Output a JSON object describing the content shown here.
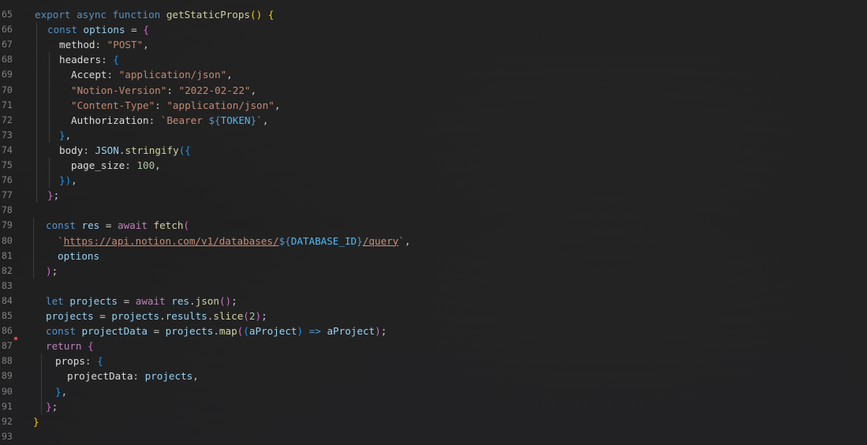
{
  "editor": {
    "lines": [
      {
        "n": "65",
        "tokens": [
          [
            "kw",
            "export "
          ],
          [
            "kw",
            "async "
          ],
          [
            "kw",
            "function "
          ],
          [
            "fn",
            "getStaticProps"
          ],
          [
            "b1",
            "() {"
          ]
        ]
      },
      {
        "n": "66",
        "tokens": [
          [
            "kw",
            "const "
          ],
          [
            "var",
            "options"
          ],
          [
            "punc",
            " = "
          ],
          [
            "b2",
            "{"
          ]
        ]
      },
      {
        "n": "67",
        "tokens": [
          [
            "prop",
            "method"
          ],
          [
            "punc",
            ": "
          ],
          [
            "str",
            "\"POST\""
          ],
          [
            "punc",
            ","
          ]
        ]
      },
      {
        "n": "68",
        "tokens": [
          [
            "prop",
            "headers"
          ],
          [
            "punc",
            ": "
          ],
          [
            "b3",
            "{"
          ]
        ]
      },
      {
        "n": "69",
        "tokens": [
          [
            "prop",
            "Accept"
          ],
          [
            "punc",
            ": "
          ],
          [
            "str",
            "\"application/json\""
          ],
          [
            "punc",
            ","
          ]
        ]
      },
      {
        "n": "70",
        "tokens": [
          [
            "str",
            "\"Notion-Version\""
          ],
          [
            "punc",
            ": "
          ],
          [
            "str",
            "\"2022-02-22\""
          ],
          [
            "punc",
            ","
          ]
        ]
      },
      {
        "n": "71",
        "tokens": [
          [
            "str",
            "\"Content-Type\""
          ],
          [
            "punc",
            ": "
          ],
          [
            "str",
            "\"application/json\""
          ],
          [
            "punc",
            ","
          ]
        ]
      },
      {
        "n": "72",
        "tokens": [
          [
            "prop",
            "Authorization"
          ],
          [
            "punc",
            ": "
          ],
          [
            "str",
            "`Bearer "
          ],
          [
            "tpl",
            "${"
          ],
          [
            "tplvar",
            "TOKEN"
          ],
          [
            "tpl",
            "}"
          ],
          [
            "str",
            "`"
          ],
          [
            "punc",
            ","
          ]
        ]
      },
      {
        "n": "73",
        "tokens": [
          [
            "b3",
            "}"
          ],
          [
            "punc",
            ","
          ]
        ]
      },
      {
        "n": "74",
        "tokens": [
          [
            "prop",
            "body"
          ],
          [
            "punc",
            ": "
          ],
          [
            "var",
            "JSON"
          ],
          [
            "punc",
            "."
          ],
          [
            "fn",
            "stringify"
          ],
          [
            "b3",
            "({"
          ]
        ]
      },
      {
        "n": "75",
        "tokens": [
          [
            "prop",
            "page_size"
          ],
          [
            "punc",
            ": "
          ],
          [
            "num",
            "100"
          ],
          [
            "punc",
            ","
          ]
        ]
      },
      {
        "n": "76",
        "tokens": [
          [
            "b3",
            "})"
          ],
          [
            "punc",
            ","
          ]
        ]
      },
      {
        "n": "77",
        "tokens": [
          [
            "b2",
            "}"
          ],
          [
            "punc",
            ";"
          ]
        ]
      },
      {
        "n": "78",
        "tokens": []
      },
      {
        "n": "79",
        "tokens": [
          [
            "kw",
            "const "
          ],
          [
            "var",
            "res"
          ],
          [
            "punc",
            " = "
          ],
          [
            "kw2",
            "await "
          ],
          [
            "fn",
            "fetch"
          ],
          [
            "b2",
            "("
          ]
        ]
      },
      {
        "n": "80",
        "tokens": [
          [
            "str",
            "`"
          ],
          [
            "url",
            "https://api.notion.com/v1/databases/"
          ],
          [
            "tpl",
            "${"
          ],
          [
            "tplvar",
            "DATABASE_ID"
          ],
          [
            "tpl",
            "}"
          ],
          [
            "url",
            "/query"
          ],
          [
            "str",
            "`"
          ],
          [
            "punc",
            ","
          ]
        ]
      },
      {
        "n": "81",
        "tokens": [
          [
            "var",
            "options"
          ]
        ]
      },
      {
        "n": "82",
        "tokens": [
          [
            "b2",
            ")"
          ],
          [
            "punc",
            ";"
          ]
        ]
      },
      {
        "n": "83",
        "tokens": []
      },
      {
        "n": "84",
        "tokens": [
          [
            "kw",
            "let "
          ],
          [
            "var",
            "projects"
          ],
          [
            "punc",
            " = "
          ],
          [
            "kw2",
            "await "
          ],
          [
            "var",
            "res"
          ],
          [
            "punc",
            "."
          ],
          [
            "fn",
            "json"
          ],
          [
            "b2",
            "()"
          ],
          [
            "punc",
            ";"
          ]
        ]
      },
      {
        "n": "85",
        "tokens": [
          [
            "var",
            "projects"
          ],
          [
            "punc",
            " = "
          ],
          [
            "var",
            "projects"
          ],
          [
            "punc",
            "."
          ],
          [
            "var",
            "results"
          ],
          [
            "punc",
            "."
          ],
          [
            "fn",
            "slice"
          ],
          [
            "b2",
            "("
          ],
          [
            "num",
            "2"
          ],
          [
            "b2",
            ")"
          ],
          [
            "punc",
            ";"
          ]
        ]
      },
      {
        "n": "86",
        "tokens": [
          [
            "kw",
            "const "
          ],
          [
            "var",
            "projectData"
          ],
          [
            "punc",
            " = "
          ],
          [
            "var",
            "projects"
          ],
          [
            "punc",
            "."
          ],
          [
            "fn",
            "map"
          ],
          [
            "b2",
            "("
          ],
          [
            "b3",
            "("
          ],
          [
            "var",
            "aProject"
          ],
          [
            "b3",
            ")"
          ],
          [
            "kw",
            " => "
          ],
          [
            "var",
            "aProject"
          ],
          [
            "b2",
            ")"
          ],
          [
            "punc",
            ";"
          ]
        ]
      },
      {
        "n": "87",
        "tokens": [
          [
            "kw2",
            "return "
          ],
          [
            "b2",
            "{"
          ]
        ]
      },
      {
        "n": "88",
        "tokens": [
          [
            "prop",
            "props"
          ],
          [
            "punc",
            ": "
          ],
          [
            "b3",
            "{"
          ]
        ]
      },
      {
        "n": "89",
        "tokens": [
          [
            "prop",
            "projectData"
          ],
          [
            "punc",
            ": "
          ],
          [
            "var",
            "projects"
          ],
          [
            "punc",
            ","
          ]
        ]
      },
      {
        "n": "90",
        "tokens": [
          [
            "b3",
            "}"
          ],
          [
            "punc",
            ","
          ]
        ]
      },
      {
        "n": "91",
        "tokens": [
          [
            "b2",
            "}"
          ],
          [
            "punc",
            ";"
          ]
        ]
      },
      {
        "n": "92",
        "tokens": [
          [
            "b1",
            "}"
          ]
        ]
      },
      {
        "n": "93",
        "tokens": []
      }
    ]
  },
  "colors": {
    "background": "#1e1e1e",
    "keyword": "#569cd6",
    "control_keyword": "#c586c0",
    "function": "#dcdcaa",
    "variable": "#9cdcfe",
    "string": "#ce9178",
    "number": "#b5cea8"
  }
}
